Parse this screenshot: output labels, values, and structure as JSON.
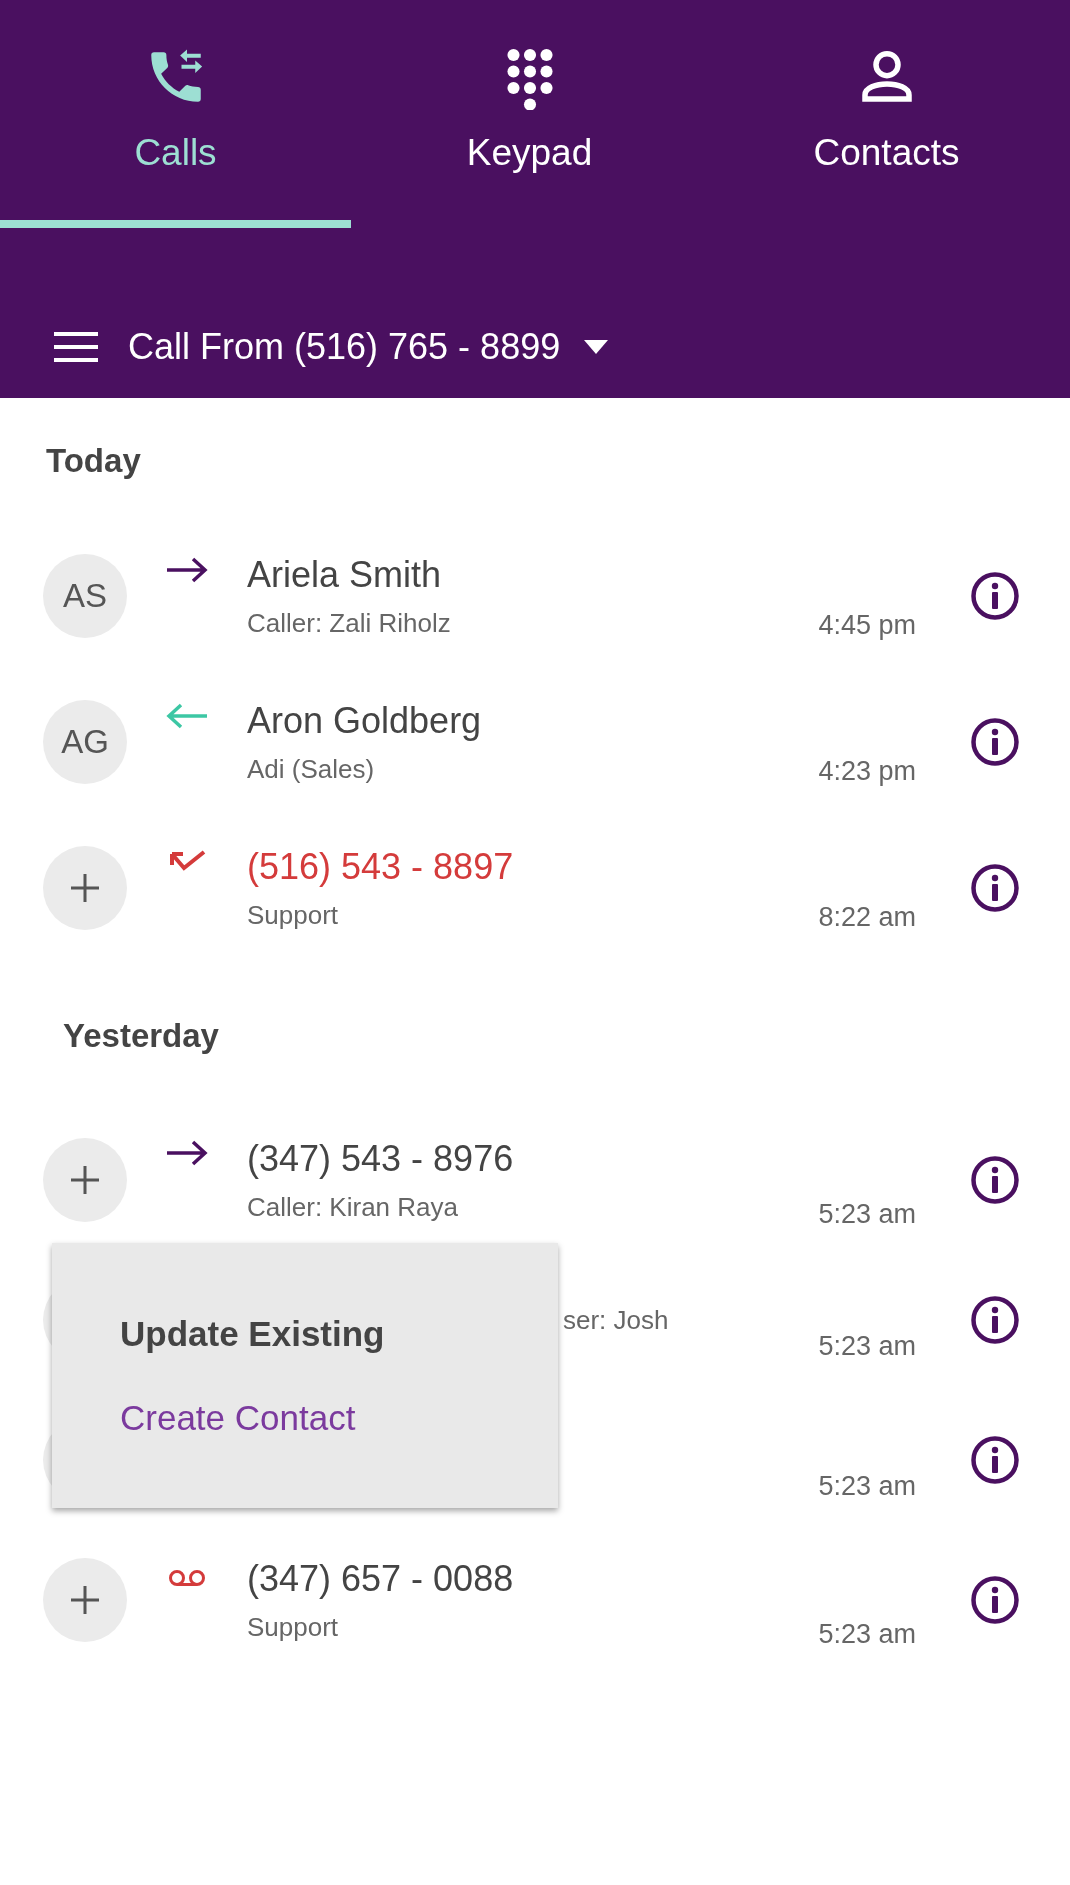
{
  "tabs": [
    {
      "label": "Calls",
      "selected": true
    },
    {
      "label": "Keypad",
      "selected": false
    },
    {
      "label": "Contacts",
      "selected": false
    }
  ],
  "call_from": {
    "label": "Call From (516) 765 - 8899"
  },
  "sections": [
    {
      "title": "Today",
      "rows": [
        {
          "avatar": "AS",
          "kind": "outgoing",
          "title": "Ariela Smith",
          "subtitle": "Caller: Zali Riholz",
          "time": "4:45 pm"
        },
        {
          "avatar": "AG",
          "kind": "incoming",
          "title": "Aron Goldberg",
          "subtitle": "Adi (Sales)",
          "time": "4:23 pm"
        },
        {
          "kind": "missed",
          "title": "(516) 543 - 8897",
          "subtitle": "Support",
          "time": "8:22 am"
        }
      ]
    },
    {
      "title": "Yesterday",
      "rows": [
        {
          "kind": "outgoing",
          "title": "(347) 543 - 8976",
          "subtitle": "Caller: Kiran Raya",
          "time": "5:23 am"
        },
        {
          "covered": true,
          "subtitle": "ser: Josh",
          "time": "5:23 am"
        },
        {
          "covered": true,
          "time": "5:23 am"
        },
        {
          "kind": "voicemail",
          "title": "(347) 657 - 0088",
          "subtitle": "Support",
          "time": "5:23 am"
        }
      ],
      "menu": [
        {
          "label": "Update Existing",
          "accent": false
        },
        {
          "label": "Create Contact",
          "accent": true
        }
      ]
    }
  ]
}
